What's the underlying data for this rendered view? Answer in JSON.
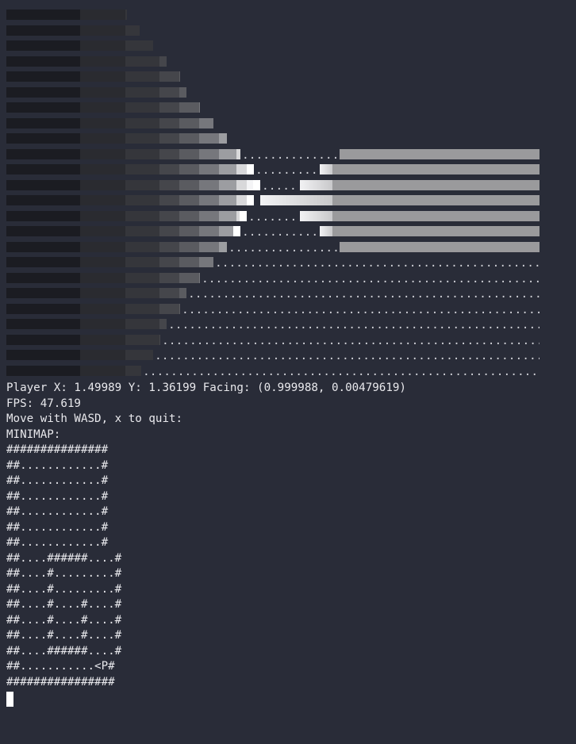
{
  "terminal": {
    "background": "#292c38",
    "foreground": "#e6e6ea"
  },
  "raycast_view": {
    "rows": 24,
    "wall_shades": [
      "#1b1c22",
      "#2a2b30",
      "#35363b",
      "#45464b",
      "#5a5b60",
      "#76777c",
      "#9c9da1",
      "#d8d8da",
      "#f4f4f6"
    ],
    "far_wall_color": "#9a9a9c",
    "floor_glyph": "."
  },
  "status": {
    "player_line": "Player X: 1.49989 Y: 1.36199 Facing: (0.999988, 0.00479619)",
    "fps_line": "FPS: 47.619",
    "help_line": "Move with WASD, x to quit:"
  },
  "minimap": {
    "title": "MINIMAP:",
    "rows": [
      "###############",
      "##............#",
      "##............#",
      "##............#",
      "##............#",
      "##............#",
      "##............#",
      "##....######....#",
      "##....#.........#",
      "##....#.........#",
      "##....#....#....#",
      "##....#....#....#",
      "##....#....#....#",
      "##....######....#",
      "##...........<P#",
      "################"
    ]
  }
}
